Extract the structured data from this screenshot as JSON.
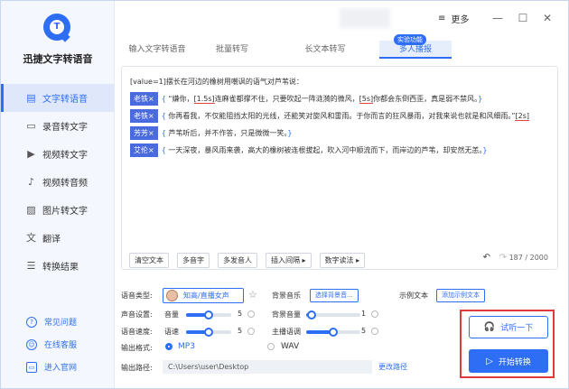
{
  "app": {
    "name": "迅捷文字转语音",
    "logo_letter": "T"
  },
  "titlebar": {
    "more_label": "更多",
    "menu_icon": "≡",
    "minimize": "—",
    "maximize": "☐",
    "close": "✕"
  },
  "sidebar": {
    "items": [
      {
        "label": "文字转语音",
        "icon": "▤"
      },
      {
        "label": "录音转文字",
        "icon": "▭"
      },
      {
        "label": "视频转文字",
        "icon": "▶"
      },
      {
        "label": "视频转音频",
        "icon": "♪"
      },
      {
        "label": "图片转文字",
        "icon": "▨"
      },
      {
        "label": "翻译",
        "icon": "文"
      },
      {
        "label": "转换结果",
        "icon": "☰"
      }
    ],
    "footer": [
      {
        "label": "常见问题",
        "icon": "?"
      },
      {
        "label": "在线客服",
        "icon": "☺"
      },
      {
        "label": "进入官网",
        "icon": "▭"
      }
    ]
  },
  "tabs": [
    "输入文字转语音",
    "批量转写",
    "长文本转写",
    "多人播报"
  ],
  "tab_tag": "实验功能",
  "editor": {
    "intro": "[value=1]摆长在河边的橡树用嘲讽的语气对芦苇说：",
    "lines": [
      {
        "role": "老铁×",
        "text": "“嫌你，",
        "p1": "[1.5s]",
        "text2": "连麻雀都撑不住，只要吹起一阵涟漪的微风，",
        "p2": "[5s]",
        "text3": "你都会东倒西歪，真是弱不禁风。"
      },
      {
        "role": "老铁×",
        "text": "你再看我，不仅能阻挡太阳的光线，还能笑对旋风和雷雨。于你而言的狂风暴雨，对我来说也就是和风细雨。”",
        "p1": "[2s]"
      },
      {
        "role": "芳芳×",
        "text": "芦苇听后，并不作答，只是微微一笑。"
      },
      {
        "role": "艾伦×",
        "text": "一天深夜，暴风雨来袭，高大的橡树被连根拔起，吹入河中顺流而下，而岸边的芦苇，却安然无恙。"
      }
    ],
    "toolbar": [
      "清空文本",
      "多音字",
      "多发音人",
      "插入间隔 ▸",
      "数字读法 ▸"
    ],
    "counter": "187 / 2000",
    "undo": "↶",
    "redo": "↷"
  },
  "settings": {
    "voice_type_label": "语音类型:",
    "voice_name": "知高/直播女声",
    "star": "☆",
    "bgm_label": "背景音乐",
    "bgm_button": "选择背景音...",
    "example_label": "示例文本",
    "example_button": "添加示例文本",
    "sound_label": "声音设置:",
    "volume_label": "音量",
    "volume_value": "5",
    "bg_volume_label": "背景音量",
    "bg_volume_value": "1",
    "speed_label": "语音速度:",
    "speed_sub": "语速",
    "speed_value": "5",
    "host_speed_label": "主播语调",
    "host_speed_value": "5",
    "format_label": "输出格式:",
    "format_options": [
      "MP3",
      "WAV"
    ],
    "format_selected": "MP3",
    "path_label": "输出路径:",
    "path_value": "C:\\Users\\user\\Desktop",
    "change_path": "更改路径"
  },
  "actions": {
    "listen": "试听一下",
    "start": "开始转换",
    "listen_icon": "🎧",
    "start_icon": "▷"
  },
  "colors": {
    "accent": "#2d6ef5",
    "highlight_border": "#e03a3a",
    "role_tag": "#4a6be0"
  }
}
